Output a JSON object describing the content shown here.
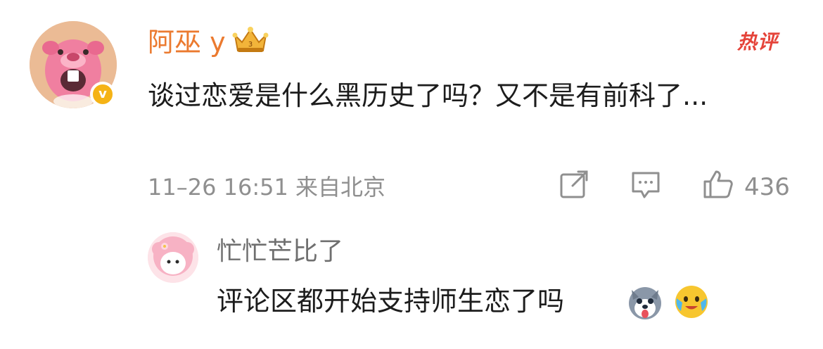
{
  "comment": {
    "username": "阿巫 y",
    "hot_tag": "热评",
    "text": "谈过恋爱是什么黑历史了吗？又不是有前科了...",
    "meta": "11–26 16:51 来自北京",
    "like_count": "436",
    "icons": [
      "verified-badge-icon",
      "crown-level-icon",
      "repost-icon",
      "comment-icon",
      "like-icon"
    ]
  },
  "reply": {
    "username": "忙忙芒比了",
    "text": "评论区都开始支持师生恋了吗",
    "emojis": [
      "husky-dog-emoji",
      "tearful-smile-emoji"
    ]
  },
  "colors": {
    "username": "#eb7a2f",
    "hot_tag": "#e5443a",
    "meta": "#8f8f8f",
    "text": "#1c1c1c",
    "badge": "#f5b316"
  }
}
